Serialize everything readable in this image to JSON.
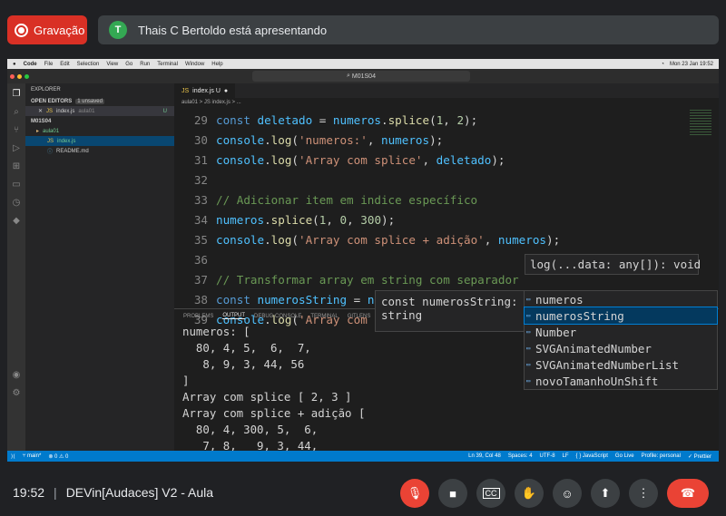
{
  "meet": {
    "recording": "Gravação",
    "avatar": "T",
    "presenter": "Thais C Bertoldo está apresentando",
    "time": "19:52",
    "sep": "|",
    "meeting_title": "DEVin[Audaces] V2 - Aula"
  },
  "mac": {
    "menu": [
      "Code",
      "File",
      "Edit",
      "Selection",
      "View",
      "Go",
      "Run",
      "Terminal",
      "Window",
      "Help"
    ],
    "clock": "Mon 23 Jan 19:52"
  },
  "vscode": {
    "search": "M01S04",
    "explorer": "EXPLORER",
    "open_editors": "OPEN EDITORS",
    "unsaved": "1 unsaved",
    "open_file": "index.js",
    "open_file_dir": "aula01",
    "open_file_badge": "U",
    "root": "M01S04",
    "folder": "aula01",
    "file1": "index.js",
    "file2": "README.md",
    "tab": "index.js U",
    "breadcrumb": "aula01 > JS index.js > ...",
    "panel_tabs": [
      "PROBLEMS",
      "OUTPUT",
      "DEBUG CONSOLE",
      "TERMINAL",
      "GITLENS"
    ],
    "signature": "log(...data: any[]): void",
    "hover": [
      "const numerosString: ",
      "string"
    ],
    "suggestions": [
      "numeros",
      "numerosString",
      "Number",
      "SVGAnimatedNumber",
      "SVGAnimatedNumberList",
      "novoTamanhoUnShift"
    ],
    "status_left": [
      "main*",
      "⊗ 0 ⚠ 0"
    ],
    "status_right": [
      "Ln 39, Col 48",
      "Spaces: 4",
      "UTF-8",
      "LF",
      "{ } JavaScript",
      "Go Live",
      "Profile: personal",
      "✓ Prettier"
    ]
  },
  "code_lines": [
    {
      "n": "29",
      "t": "const deletado = numeros.splice(1, 2);"
    },
    {
      "n": "30",
      "t": "console.log('numeros:', numeros);"
    },
    {
      "n": "31",
      "t": "console.log('Array com splice', deletado);"
    },
    {
      "n": "32",
      "t": ""
    },
    {
      "n": "33",
      "t": "// Adicionar item em indice específico"
    },
    {
      "n": "34",
      "t": "numeros.splice(1, 0, 300);"
    },
    {
      "n": "35",
      "t": "console.log('Array com splice + adição', numeros);"
    },
    {
      "n": "36",
      "t": ""
    },
    {
      "n": "37",
      "t": "// Transformar array em string com separador"
    },
    {
      "n": "38",
      "t": "const numerosString = numeros.join()"
    },
    {
      "n": "39",
      "t": "console.log('Array com Join sem separador', num)"
    }
  ],
  "output_lines": [
    "numeros: [",
    "  80, 4, 5,  6,  7,",
    "   8, 9, 3, 44, 56",
    "]",
    "Array com splice [ 2, 3 ]",
    "Array com splice + adição [",
    "  80, 4, 300, 5,  6,",
    "   7, 8,   9, 3, 44,"
  ]
}
